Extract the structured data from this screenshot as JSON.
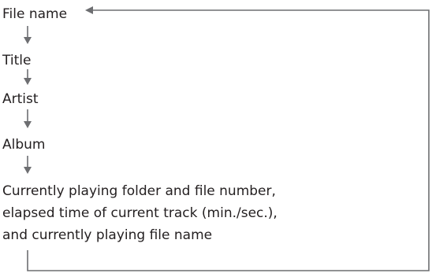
{
  "diagram": {
    "nodes": [
      {
        "id": "file-name",
        "text": "File name"
      },
      {
        "id": "title",
        "text": "Title"
      },
      {
        "id": "artist",
        "text": "Artist"
      },
      {
        "id": "album",
        "text": "Album"
      },
      {
        "id": "current",
        "lines": [
          "Currently playing folder and file number,",
          "elapsed time of current track (min./sec.),",
          "and currently playing file name"
        ]
      }
    ],
    "edges": [
      {
        "from": "file-name",
        "to": "title"
      },
      {
        "from": "title",
        "to": "artist"
      },
      {
        "from": "artist",
        "to": "album"
      },
      {
        "from": "album",
        "to": "current"
      },
      {
        "from": "current",
        "to": "file-name"
      }
    ]
  },
  "colors": {
    "text": "#231f20",
    "connector": "#6d6e71",
    "background": "#ffffff"
  }
}
